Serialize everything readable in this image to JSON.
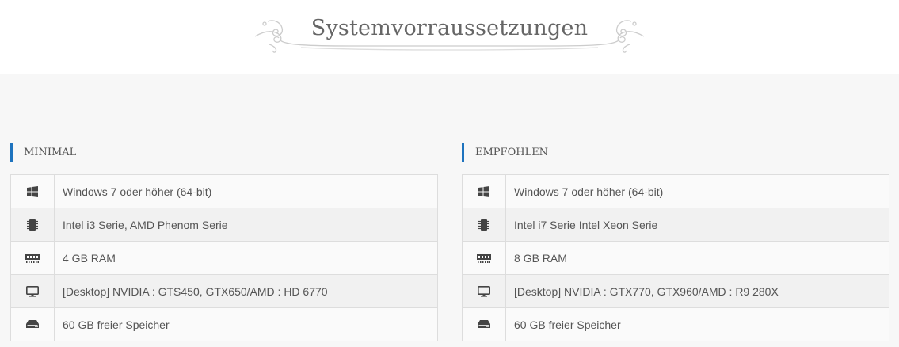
{
  "page_title": "Systemvorraussetzungen",
  "accent_color": "#1e73be",
  "columns": [
    {
      "heading": "MINIMAL",
      "rows": [
        {
          "icon": "windows-icon",
          "text": "Windows 7 oder höher (64-bit)"
        },
        {
          "icon": "cpu-chip-icon",
          "text": "Intel i3 Serie, AMD Phenom Serie"
        },
        {
          "icon": "memory-icon",
          "text": "4 GB RAM"
        },
        {
          "icon": "desktop-monitor-icon",
          "text": "[Desktop] NVIDIA : GTS450, GTX650/AMD : HD 6770"
        },
        {
          "icon": "hard-drive-icon",
          "text": "60 GB freier Speicher"
        }
      ]
    },
    {
      "heading": "EMPFOHLEN",
      "rows": [
        {
          "icon": "windows-icon",
          "text": "Windows 7 oder höher (64-bit)"
        },
        {
          "icon": "cpu-chip-icon",
          "text": "Intel i7 Serie Intel Xeon Serie"
        },
        {
          "icon": "memory-icon",
          "text": "8 GB RAM"
        },
        {
          "icon": "desktop-monitor-icon",
          "text": "[Desktop] NVIDIA : GTX770, GTX960/AMD : R9 280X"
        },
        {
          "icon": "hard-drive-icon",
          "text": "60 GB freier Speicher"
        }
      ]
    }
  ]
}
